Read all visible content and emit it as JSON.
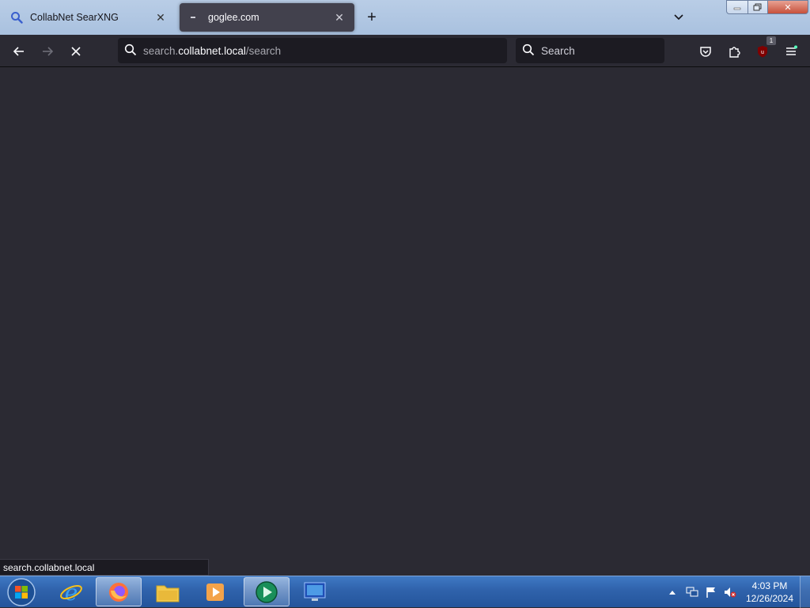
{
  "browser": {
    "tabs": [
      {
        "label": "CollabNet SearXNG",
        "state": "inactive",
        "favicon": "search-favicon"
      },
      {
        "label": "goglee.com",
        "state": "active",
        "favicon": "loading-favicon"
      }
    ],
    "new_tab_icon": "plus-icon",
    "tab_list_icon": "chevron-down-icon"
  },
  "toolbar": {
    "back_icon": "arrow-left-icon",
    "forward_icon": "arrow-right-icon",
    "stop_icon": "close-icon",
    "url_domain": "search.collabnet.local",
    "url_path": "/search",
    "search_placeholder": "Search",
    "pocket_icon": "pocket-icon",
    "extensions_icon": "puzzle-icon",
    "ublock_badge": "1",
    "menu_icon": "hamburger-icon"
  },
  "status": {
    "text": "search.collabnet.local"
  },
  "taskbar": {
    "items": [
      "start-orb",
      "internet-explorer",
      "firefox",
      "file-explorer",
      "media-player",
      "app-green-circle",
      "remote-desktop"
    ],
    "time": "4:03 PM",
    "date": "12/26/2024"
  },
  "colors": {
    "toolbar_bg": "#2b2a33",
    "urlbar_bg": "#1c1b22",
    "active_tab_bg": "#42414d",
    "taskbar": "#2f62ab"
  }
}
